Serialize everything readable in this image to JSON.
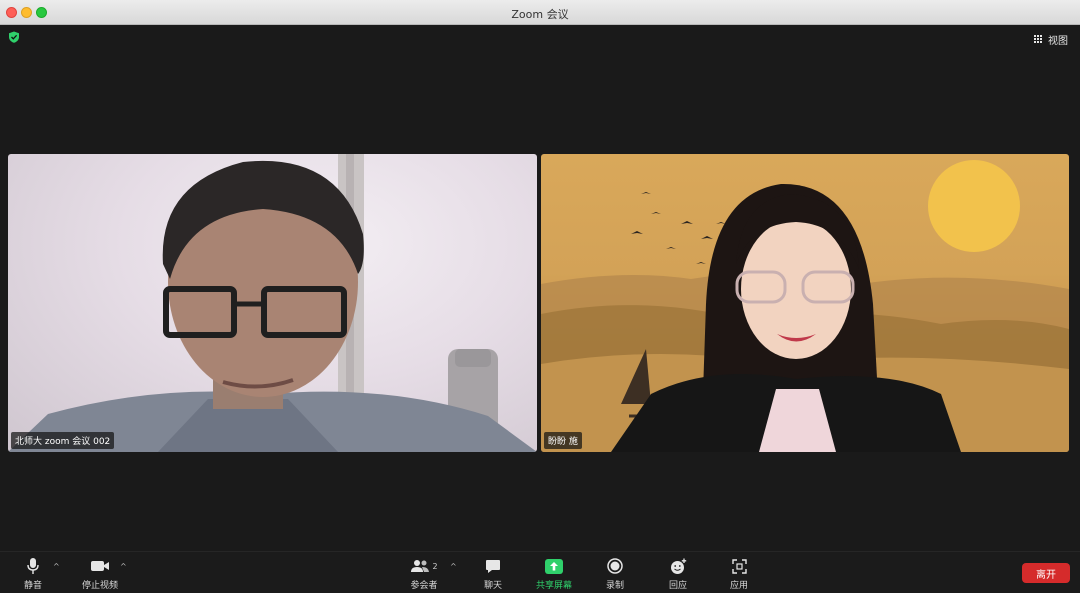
{
  "window": {
    "title": "Zoom 会议"
  },
  "top_bar": {
    "view_label": "视图"
  },
  "participants": [
    {
      "name": "北师大 zoom 会议 002"
    },
    {
      "name": "盼盼 施"
    }
  ],
  "toolbar": {
    "mute_label": "静音",
    "video_label": "停止视频",
    "participants_label": "参会者",
    "participants_count": "2",
    "chat_label": "聊天",
    "share_label": "共享屏幕",
    "record_label": "录制",
    "reactions_label": "回应",
    "apps_label": "应用",
    "leave_label": "离开"
  },
  "colors": {
    "leave": "#d52b2b",
    "share": "#2fd06b",
    "security": "#2fd06b"
  }
}
